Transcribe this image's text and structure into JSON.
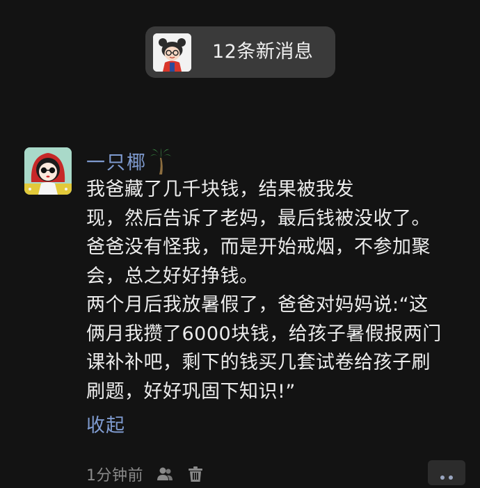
{
  "notification": {
    "new_messages_label": "12条新消息",
    "avatar_icon": "cartoon-girl-avatar-icon"
  },
  "post": {
    "avatar_icon": "red-hood-girl-avatar-icon",
    "username": "一只椰",
    "username_emoji": "palm-tree-icon",
    "content_lines": [
      "我爸藏了几千块钱，结果被我发",
      "现，然后告诉了老妈，最后钱被没收了。",
      "爸爸没有怪我，而是开始戒烟，不参加聚",
      "会，总之好好挣钱。",
      "两个月后我放暑假了，爸爸对妈妈说:“这",
      "俩月我攒了6000块钱，给孩子暑假报两门",
      "课补补吧，剩下的钱买几套试卷给孩子刷",
      "刷题，好好巩固下知识!”"
    ],
    "collapse_label": "收起",
    "time": "1分钟前",
    "footer_icons": [
      "people-icon",
      "trash-icon",
      "more-icon"
    ]
  },
  "colors": {
    "background": "#131313",
    "pill_background": "#3a3a3a",
    "link_blue": "#7f9bd0",
    "text_primary": "#ececec",
    "text_secondary": "#8a8a8a"
  }
}
